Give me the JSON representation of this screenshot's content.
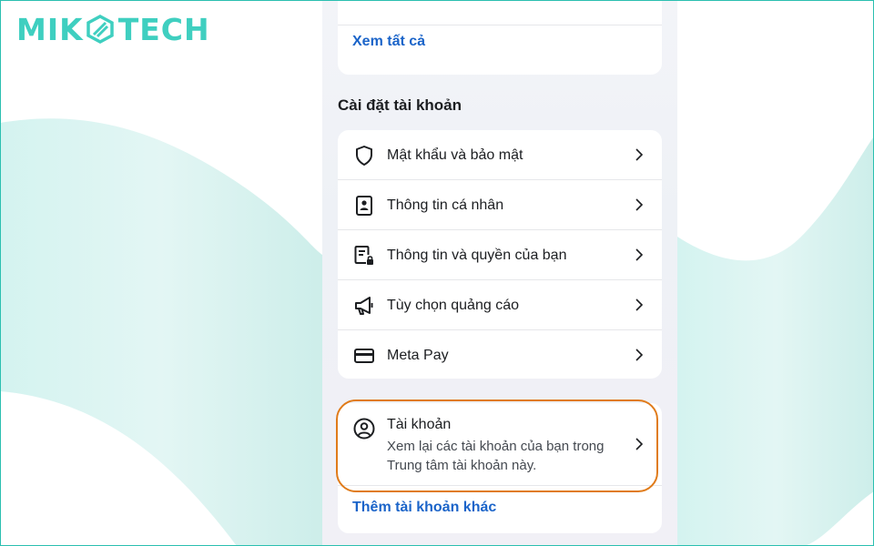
{
  "logo": {
    "text_left": "MIK",
    "text_right": "TECH",
    "color": "#3fcfc0"
  },
  "top_card": {
    "see_all": "Xem tất cả"
  },
  "settings": {
    "title": "Cài đặt tài khoản",
    "items": [
      {
        "label": "Mật khẩu và bảo mật",
        "icon": "shield-icon"
      },
      {
        "label": "Thông tin cá nhân",
        "icon": "id-card-icon"
      },
      {
        "label": "Thông tin và quyền của bạn",
        "icon": "document-lock-icon"
      },
      {
        "label": "Tùy chọn quảng cáo",
        "icon": "megaphone-icon"
      },
      {
        "label": "Meta Pay",
        "icon": "credit-card-icon"
      }
    ]
  },
  "account": {
    "title": "Tài khoản",
    "description": "Xem lại các tài khoản của bạn trong Trung tâm tài khoản này.",
    "icon": "user-circle-icon",
    "add_account": "Thêm tài khoản khác"
  },
  "colors": {
    "link": "#1b64c9",
    "highlight": "#e07b1a",
    "brand": "#3fcfc0"
  }
}
